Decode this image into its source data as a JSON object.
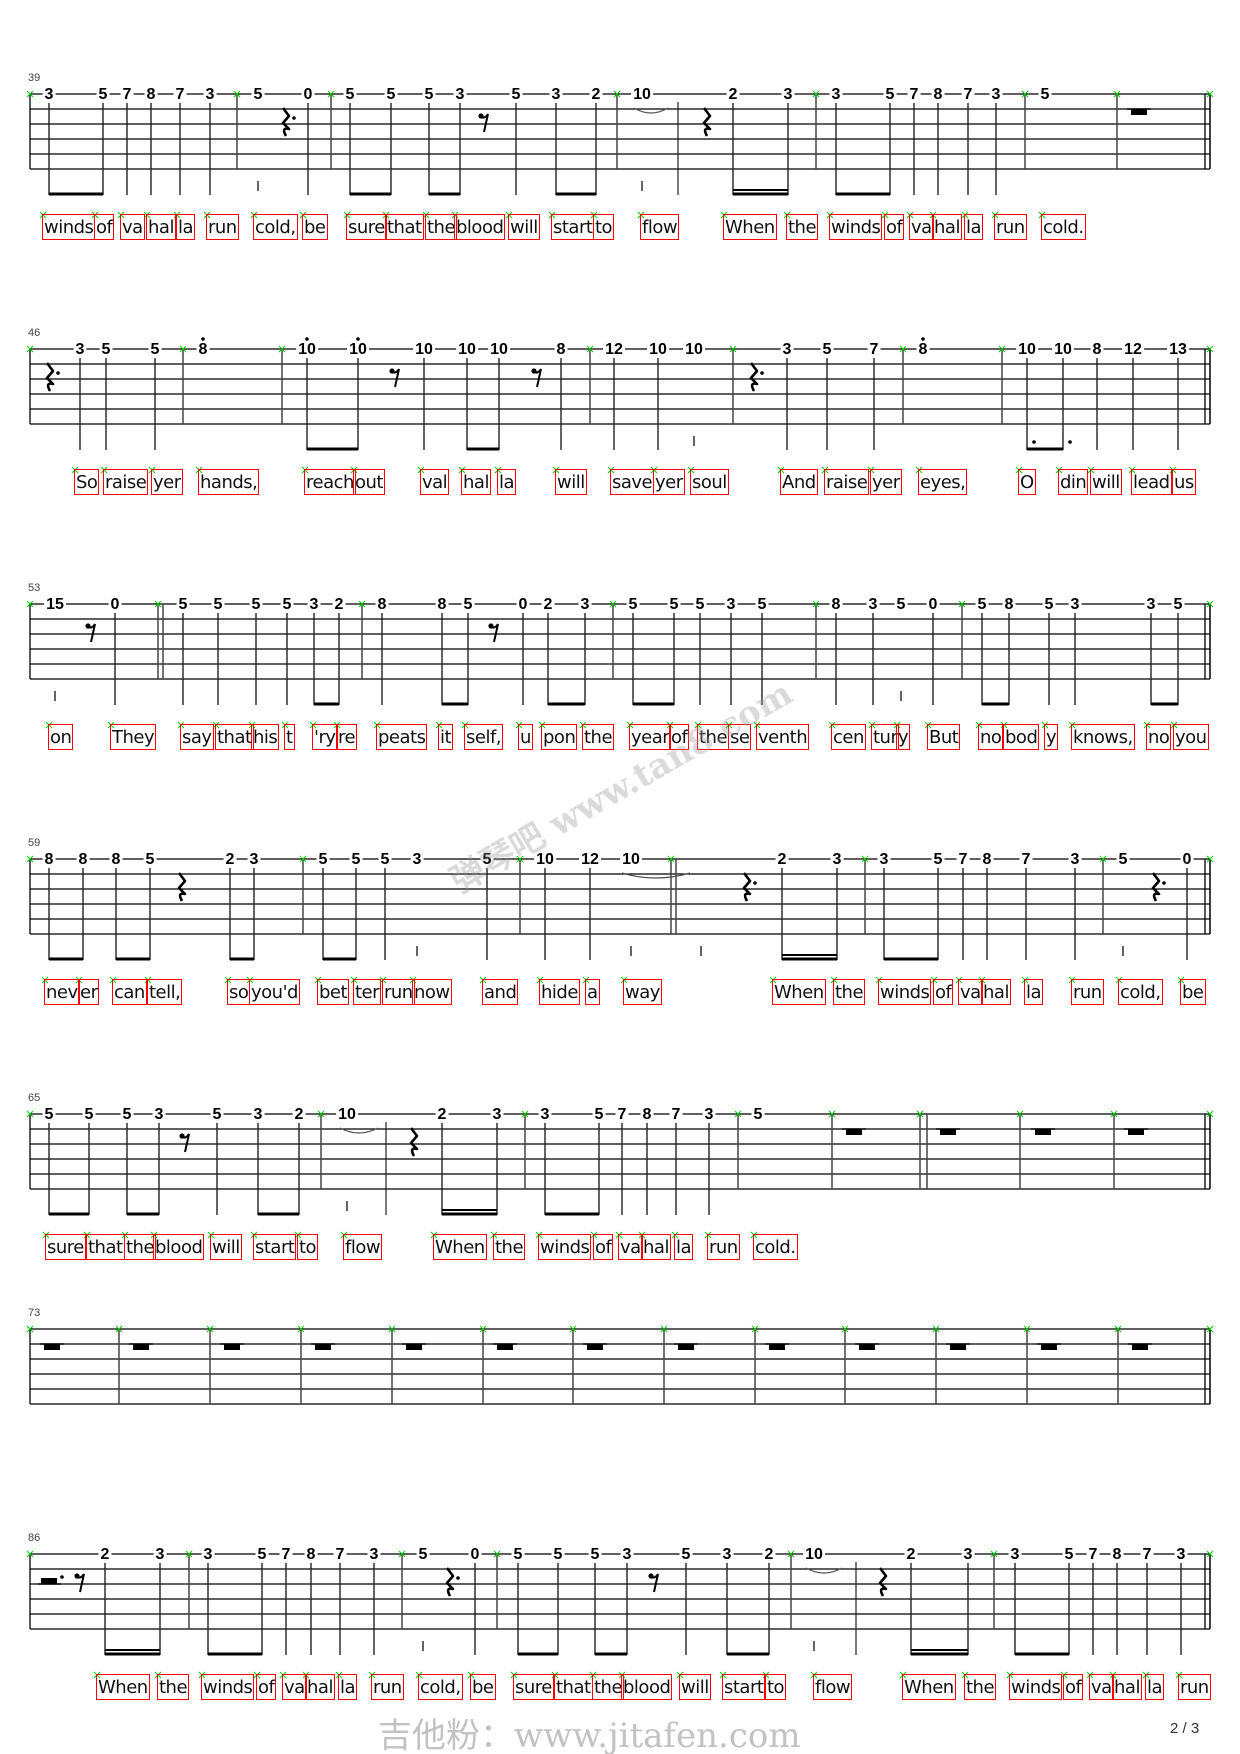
{
  "page_number": "2 / 3",
  "watermarks": [
    "弹琴吧 www.tan8.com",
    "吉他粉：www.jitafen.com"
  ],
  "colors": {
    "lyric_box": "#ff0000",
    "marker": "#00cc00",
    "ink": "#000000"
  },
  "systems": [
    {
      "measure_number": "39",
      "frets": [
        "3",
        "5",
        "7",
        "8",
        "7",
        "3",
        "5",
        "0",
        "5",
        "5",
        "5",
        "3",
        "5",
        "3",
        "2",
        "10",
        "2",
        "3",
        "3",
        "5",
        "7",
        "8",
        "7",
        "3",
        "5"
      ],
      "lyrics": [
        "winds",
        "of",
        "va",
        "hal",
        "la",
        "run",
        "cold,",
        "be",
        "sure",
        "that",
        "the",
        "blood",
        "will",
        "start",
        "to",
        "flow",
        "When",
        "the",
        "winds",
        "of",
        "va",
        "hal",
        "la",
        "run",
        "cold."
      ]
    },
    {
      "measure_number": "46",
      "frets": [
        "3",
        "5",
        "5",
        "8",
        "10",
        "10",
        "10",
        "10",
        "10",
        "8",
        "12",
        "10",
        "10",
        "3",
        "5",
        "7",
        "8",
        "10",
        "10",
        "8",
        "12",
        "13"
      ],
      "lyrics": [
        "So",
        "raise",
        "yer",
        "hands,",
        "reach",
        "out",
        "val",
        "hal",
        "la",
        "will",
        "save",
        "yer",
        "soul",
        "And",
        "raise",
        "yer",
        "eyes,",
        "O",
        "din",
        "will",
        "lead",
        "us"
      ]
    },
    {
      "measure_number": "53",
      "frets": [
        "15",
        "0",
        "5",
        "5",
        "5",
        "5",
        "3",
        "2",
        "8",
        "8",
        "5",
        "0",
        "2",
        "3",
        "5",
        "5",
        "5",
        "3",
        "5",
        "8",
        "3",
        "5",
        "0",
        "5",
        "8",
        "5",
        "3",
        "3",
        "5"
      ],
      "lyrics": [
        "on",
        "They",
        "say",
        "that",
        "his",
        "t",
        "'ry",
        "re",
        "peats",
        "it",
        "self,",
        "u",
        "pon",
        "the",
        "year",
        "of",
        "the",
        "se",
        "venth",
        "cen",
        "tur",
        "y",
        "But",
        "no",
        "bod",
        "y",
        "knows,",
        "no",
        "you"
      ]
    },
    {
      "measure_number": "59",
      "frets": [
        "8",
        "8",
        "8",
        "5",
        "2",
        "3",
        "5",
        "5",
        "5",
        "3",
        "5",
        "10",
        "12",
        "10",
        "2",
        "3",
        "3",
        "5",
        "7",
        "8",
        "7",
        "3",
        "5",
        "0"
      ],
      "lyrics": [
        "nev",
        "er",
        "can",
        "tell,",
        "so",
        "you'd",
        "bet",
        "ter",
        "run",
        "now",
        "and",
        "hide",
        "a",
        "way",
        "When",
        "the",
        "winds",
        "of",
        "va",
        "hal",
        "la",
        "run",
        "cold,",
        "be"
      ]
    },
    {
      "measure_number": "65",
      "frets": [
        "5",
        "5",
        "5",
        "3",
        "5",
        "3",
        "2",
        "10",
        "2",
        "3",
        "3",
        "5",
        "7",
        "8",
        "7",
        "3",
        "5"
      ],
      "lyrics": [
        "sure",
        "that",
        "the",
        "blood",
        "will",
        "start",
        "to",
        "flow",
        "When",
        "the",
        "winds",
        "of",
        "va",
        "hal",
        "la",
        "run",
        "cold."
      ]
    },
    {
      "measure_number": "73",
      "frets": [],
      "lyrics": []
    },
    {
      "measure_number": "86",
      "frets": [
        "2",
        "3",
        "3",
        "5",
        "7",
        "8",
        "7",
        "3",
        "5",
        "0",
        "5",
        "5",
        "5",
        "3",
        "5",
        "3",
        "2",
        "10",
        "2",
        "3",
        "3",
        "5",
        "7",
        "8",
        "7",
        "3"
      ],
      "lyrics": [
        "When",
        "the",
        "winds",
        "of",
        "va",
        "hal",
        "la",
        "run",
        "cold,",
        "be",
        "sure",
        "that",
        "the",
        "blood",
        "will",
        "start",
        "to",
        "flow",
        "When",
        "the",
        "winds",
        "of",
        "va",
        "hal",
        "la",
        "run"
      ]
    }
  ]
}
